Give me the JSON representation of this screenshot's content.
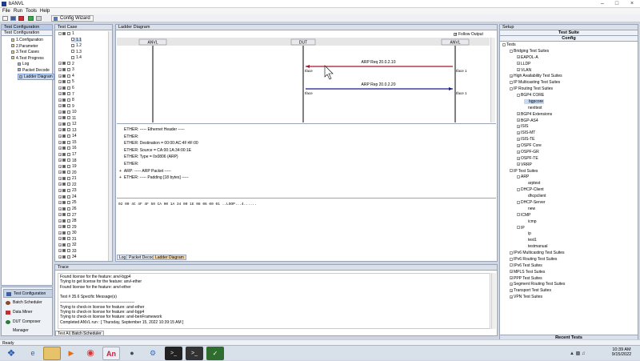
{
  "window": {
    "title": "bANVL"
  },
  "menu": [
    "File",
    "Run",
    "Tools",
    "Help"
  ],
  "toolbar": {
    "wizard_label": "Config Wizard"
  },
  "test_config": {
    "header": "Test Configuration",
    "subheader": "Test Configuration",
    "items": [
      "1.Configuration",
      "2.Parameter",
      "3.Test Cases",
      "4.Test Progress",
      "Log",
      "Packet Decode",
      "Ladder Diagram"
    ]
  },
  "test_case": {
    "header": "Test Case",
    "items": [
      "1",
      "1.1",
      "1.2",
      "1.3",
      "1.4",
      "2",
      "3",
      "4",
      "5",
      "6",
      "7",
      "8",
      "9",
      "10",
      "11",
      "12",
      "13",
      "14",
      "15",
      "16",
      "17",
      "18",
      "19",
      "20",
      "21",
      "22",
      "23",
      "24",
      "25",
      "26",
      "27",
      "28",
      "29",
      "30",
      "31",
      "32",
      "33",
      "34"
    ]
  },
  "ladder": {
    "header": "Ladder Diagram",
    "follow_output": "Follow Output",
    "nodes": [
      "ANVL",
      "DUT",
      "ANVL"
    ],
    "arrows": [
      {
        "label": "ARP Req 20.0.2.10",
        "left": "Iface",
        "right": "Iface 1"
      },
      {
        "label": "ARP Rep 20.0.2.20",
        "left": "Iface",
        "right": "Iface 1"
      }
    ]
  },
  "decode": {
    "lines": [
      "ETHER:  ----- Ethernet Header -----",
      "ETHER:",
      "ETHER:  Destination = 00:00:AC:4F:4F:00",
      "ETHER:  Source      = CA:00:1A:34:00:1E",
      "ETHER:  Type        = 0x0806 (ARP)",
      "ETHER:",
      "ARP:   ----- ARP Packet -----",
      "ETHER:  ----- Padding [18 bytes] -----"
    ],
    "hex": "02 00 4C 4F 4F 50 CA 00 1A 34 00 1E 08 06 00 01   ..LOOP...4......"
  },
  "center_tabs": [
    "Log",
    "Packet Decode",
    "Ladder Diagram"
  ],
  "trace": {
    "header": "Trace",
    "lines": [
      "Found license for the feature: anvl-bgp4",
      "Trying to get license for the feature: anvl-ether",
      "Found license for the feature: anvl-ether",
      "",
      "Test # 35.6 Specific Message(s)",
      "--------------------------------------------------------",
      "Trying to check-in license for feature: anvl-ether",
      "Trying to check-in license for feature: anvl-bgp4",
      "Trying to check-in license for feature: anvl-benFramework",
      "Completed ANVL run : [ Thursday, September 15, 2022 10:39:15 AM ]"
    ],
    "tabs": [
      "Test All",
      "Batch Scheduler"
    ]
  },
  "left_nav": {
    "buttons": [
      "Test Configuration",
      "Batch Scheduler",
      "Data Miner",
      "DUT Composer Manager"
    ]
  },
  "setup": {
    "header": "Setup",
    "suite_header": "Test Suite",
    "config_header": "Config",
    "recent": "Recent Tests",
    "tree": [
      {
        "t": "Tests",
        "d": 0
      },
      {
        "t": "Bridging Test Suites",
        "d": 1
      },
      {
        "t": "EAPOL-A",
        "d": 2
      },
      {
        "t": "LLDP",
        "d": 2
      },
      {
        "t": "VLAN",
        "d": 2
      },
      {
        "t": "High Availability Test Suites",
        "d": 1
      },
      {
        "t": "IP Multicasting Test Suites",
        "d": 1
      },
      {
        "t": "IP Routing Test Suites",
        "d": 1
      },
      {
        "t": "BGP4 CORE",
        "d": 2
      },
      {
        "t": "bgpcore",
        "d": 3
      },
      {
        "t": "nexttest",
        "d": 3
      },
      {
        "t": "BGP4 Extensions",
        "d": 2
      },
      {
        "t": "BGP-AS4",
        "d": 2
      },
      {
        "t": "ISIS",
        "d": 2
      },
      {
        "t": "ISIS-MT",
        "d": 2
      },
      {
        "t": "ISIS-TE",
        "d": 2
      },
      {
        "t": "OSPF Core",
        "d": 2
      },
      {
        "t": "OSPF-GR",
        "d": 2
      },
      {
        "t": "OSPF-TE",
        "d": 2
      },
      {
        "t": "VRRP",
        "d": 2
      },
      {
        "t": "IP Test Suites",
        "d": 1
      },
      {
        "t": "ARP",
        "d": 2
      },
      {
        "t": "arptest",
        "d": 3
      },
      {
        "t": "DHCP-Client",
        "d": 2
      },
      {
        "t": "dhcpclient",
        "d": 3
      },
      {
        "t": "DHCP-Server",
        "d": 2
      },
      {
        "t": "new",
        "d": 3
      },
      {
        "t": "ICMP",
        "d": 2
      },
      {
        "t": "icmp",
        "d": 3
      },
      {
        "t": "IP",
        "d": 2
      },
      {
        "t": "ip",
        "d": 3
      },
      {
        "t": "test1",
        "d": 3
      },
      {
        "t": "testmanual",
        "d": 3
      },
      {
        "t": "IPv6 Multicasting Test Suites",
        "d": 1
      },
      {
        "t": "IPv6 Routing Test Suites",
        "d": 1
      },
      {
        "t": "IPv6 Test Suites",
        "d": 1
      },
      {
        "t": "MPLS Test Suites",
        "d": 1
      },
      {
        "t": "PPP Test Suites",
        "d": 1
      },
      {
        "t": "Segment Routing Test Suites",
        "d": 1
      },
      {
        "t": "Transport Test Suites",
        "d": 1
      },
      {
        "t": "VPN Test Suites",
        "d": 1
      }
    ]
  },
  "status": {
    "text": "Ready"
  },
  "clock": {
    "time": "10:39 AM",
    "date": "9/15/2022"
  },
  "colors": {
    "accent": "#1c3f8c",
    "req_arrow": "#a0182a",
    "rep_arrow": "#1a1a8c",
    "active_tab": "#f9d7a6",
    "selected": "#c6d8f2"
  }
}
